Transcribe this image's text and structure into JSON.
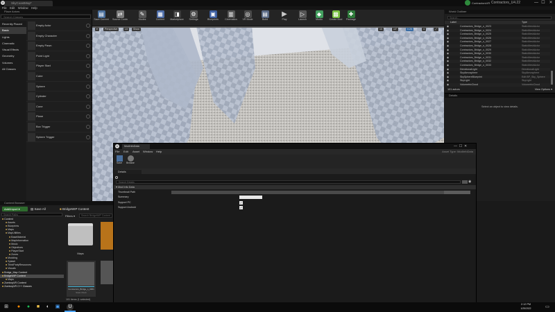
{
  "window": {
    "tab_title": "SkyCoastMap*",
    "app_title": "ContractorsVR",
    "engine_version": "Contractors_U4.22",
    "minimize": "—",
    "maximize": "☐",
    "close": "✕"
  },
  "menu": [
    "File",
    "Edit",
    "Window",
    "Help"
  ],
  "toolbar": [
    {
      "label": "Save Current"
    },
    {
      "label": "Source Control"
    },
    {
      "label": "Modes"
    },
    {
      "label": "Content"
    },
    {
      "label": "Marketplace"
    },
    {
      "label": "Settings"
    },
    {
      "label": "Blueprints"
    },
    {
      "label": "Cinematics"
    },
    {
      "label": "VR Mode"
    },
    {
      "label": "Build"
    },
    {
      "label": "Play"
    },
    {
      "label": "Launch"
    },
    {
      "label": "Modio"
    },
    {
      "label": "Create Mod"
    },
    {
      "label": "Package"
    }
  ],
  "place_actors": {
    "header": "Place Actors",
    "search_placeholder": "Search Classes",
    "categories": [
      "Recently Placed",
      "Basic",
      "Lights",
      "Cinematic",
      "Visual Effects",
      "Geometry",
      "Volumes",
      "All Classes"
    ],
    "selected_category": "Basic",
    "actors": [
      "Empty Actor",
      "Empty Character",
      "Empty Pawn",
      "Point Light",
      "Player Start",
      "Cube",
      "Sphere",
      "Cylinder",
      "Cone",
      "Plane",
      "Box Trigger",
      "Sphere Trigger"
    ]
  },
  "viewport": {
    "perspective": "Perspective",
    "lit": "Lit",
    "show": "Show",
    "grid_snap": "10",
    "rot_snap": "10°",
    "scale_snap": "0.25",
    "cam_speed": "4"
  },
  "world_outliner": {
    "header": "World Outliner",
    "search_placeholder": "Search...",
    "col_label": "Label",
    "col_type": "Type",
    "rows": [
      {
        "label": "Contractors_Bridge_o_0023",
        "type": "StaticMeshActor"
      },
      {
        "label": "Contractors_Bridge_o_0024",
        "type": "StaticMeshActor"
      },
      {
        "label": "Contractors_Bridge_o_0025",
        "type": "StaticMeshActor"
      },
      {
        "label": "Contractors_Bridge_o_0026",
        "type": "StaticMeshActor"
      },
      {
        "label": "Contractors_Bridge_o_0027",
        "type": "StaticMeshActor"
      },
      {
        "label": "Contractors_Bridge_o_0028",
        "type": "StaticMeshActor"
      },
      {
        "label": "Contractors_Bridge_o_0029",
        "type": "StaticMeshActor"
      },
      {
        "label": "Contractors_Bridge_o_0030",
        "type": "StaticMeshActor"
      },
      {
        "label": "Contractors_Bridge_o_0031",
        "type": "StaticMeshActor"
      },
      {
        "label": "Contractors_Bridge_o_0032",
        "type": "StaticMeshActor"
      },
      {
        "label": "Contractors_Bridge_o_0033",
        "type": "StaticMeshActor"
      },
      {
        "label": "DirectionalLight",
        "type": "DirectionalLight"
      },
      {
        "label": "SkyAtmosphere",
        "type": "SkyAtmosphere"
      },
      {
        "label": "SkySphereBlueprint",
        "type": "Edit BP_Sky_Sphere"
      },
      {
        "label": "SkyLight",
        "type": "SkyLight"
      },
      {
        "label": "VolumetricCloud",
        "type": "VolumetricCloud"
      }
    ],
    "count": "101 actors",
    "view_options": "View Options ▾"
  },
  "details": {
    "header": "Details",
    "empty_text": "Select an object to view details."
  },
  "content_browser": {
    "header": "Content Browser",
    "add_import": "Add/Import ▾",
    "save_all": "Save All",
    "path": "BridgeWIP Content",
    "search_placeholder": "Search Paths",
    "filters": "Filters ▾",
    "search_assets": "Search BridgeWIP Content",
    "tree": [
      {
        "label": "Content",
        "depth": 0
      },
      {
        "label": "Assets",
        "depth": 1
      },
      {
        "label": "Blueprints",
        "depth": 1
      },
      {
        "label": "Maps",
        "depth": 1
      },
      {
        "label": "MapUtilities",
        "depth": 1
      },
      {
        "label": "BaseMaterial",
        "depth": 2
      },
      {
        "label": "MapInformation",
        "depth": 2
      },
      {
        "label": "Music",
        "depth": 2
      },
      {
        "label": "Objectives",
        "depth": 2
      },
      {
        "label": "PlayerStart",
        "depth": 2
      },
      {
        "label": "Zones",
        "depth": 2
      },
      {
        "label": "Modding",
        "depth": 1
      },
      {
        "label": "Splash",
        "depth": 1
      },
      {
        "label": "ThirdPartyResources",
        "depth": 1
      },
      {
        "label": "Visuals",
        "depth": 1
      },
      {
        "label": "Bridge_Map Content",
        "depth": 0
      },
      {
        "label": "BridgeWIP Content",
        "depth": 0,
        "selected": true
      },
      {
        "label": "Maps",
        "depth": 1
      },
      {
        "label": "ZomboyVR Content",
        "depth": 0
      },
      {
        "label": "ZomboyVR C++ Classes",
        "depth": 0
      }
    ],
    "assets": [
      {
        "label": "Maps",
        "kind": "folder"
      },
      {
        "label": "Contractors_Bridge_o_0001",
        "sub": "Static Mesh",
        "kind": "mesh"
      }
    ],
    "status": "101 items (1 selected)"
  },
  "asset_editor": {
    "tab": "ModInfoData",
    "menu": [
      "File",
      "Edit",
      "Asset",
      "Window",
      "Help"
    ],
    "parent_class": "Asset Type: ModInfoData",
    "save_label": "Save",
    "browse_label": "Browse",
    "details_tab": "Details",
    "search_placeholder": "Search Details",
    "category": "Mod Info Data",
    "props": [
      {
        "name": "Thumbnail Path",
        "kind": "bar",
        "value": ""
      },
      {
        "name": "Summary",
        "kind": "text",
        "value": ""
      },
      {
        "name": "Support PC",
        "kind": "check",
        "value": "✓"
      },
      {
        "name": "Support Android",
        "kind": "check",
        "value": "✓"
      }
    ]
  },
  "taskbar": {
    "time": "2:12 PM",
    "date": "1/25/2022"
  }
}
